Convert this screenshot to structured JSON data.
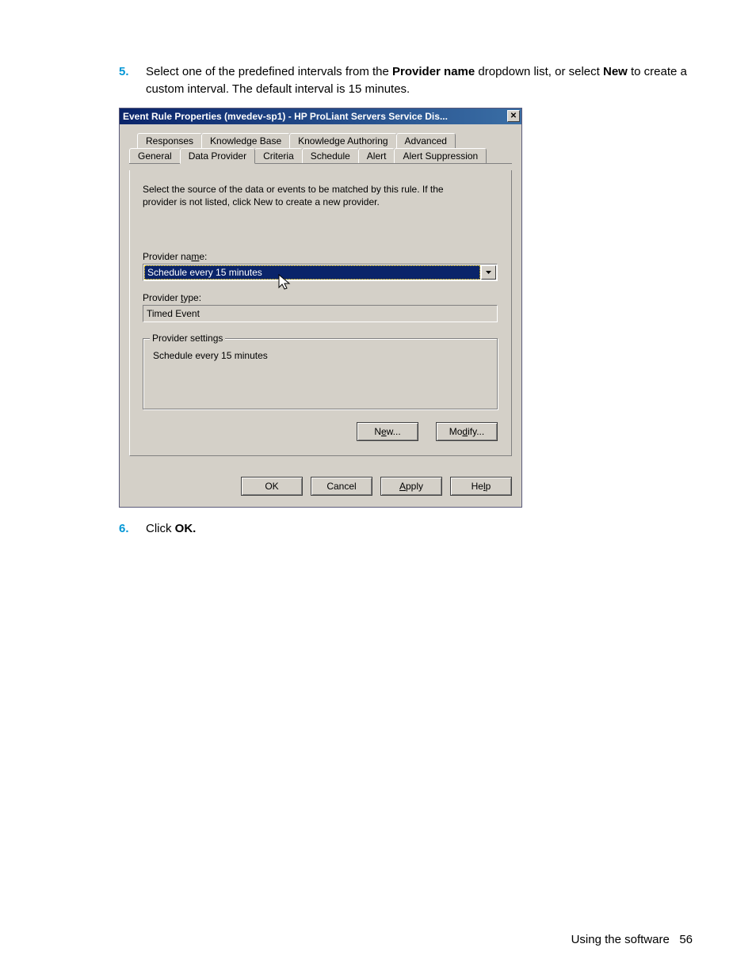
{
  "steps": {
    "s5_num": "5.",
    "s5_pre": "Select one of the predefined intervals from the ",
    "s5_b1": "Provider name",
    "s5_mid": " dropdown list, or select ",
    "s5_b2": "New",
    "s5_post": " to create a custom interval. The default interval is 15 minutes.",
    "s6_num": "6.",
    "s6_pre": "Click ",
    "s6_b1": "OK."
  },
  "dialog": {
    "title": "Event Rule Properties (mvedev-sp1) - HP ProLiant Servers Service Dis...",
    "close": "✕",
    "tabs_back": [
      "Responses",
      "Knowledge Base",
      "Knowledge Authoring",
      "Advanced"
    ],
    "tabs_front": [
      "General",
      "Data Provider",
      "Criteria",
      "Schedule",
      "Alert",
      "Alert Suppression"
    ],
    "instruction": "Select the source of the data or events to be matched by this rule.  If the provider is not listed, click New to create a new provider.",
    "provider_name_label_pre": "Provider na",
    "provider_name_label_u": "m",
    "provider_name_label_post": "e:",
    "provider_name_value": "Schedule every 15 minutes",
    "provider_type_label_pre": "Provider ",
    "provider_type_label_u": "t",
    "provider_type_label_post": "ype:",
    "provider_type_value": "Timed Event",
    "group_title": "Provider settings",
    "group_text": "Schedule every 15 minutes",
    "btn_new_pre": "N",
    "btn_new_u": "e",
    "btn_new_post": "w...",
    "btn_modify_pre": "Mo",
    "btn_modify_u": "d",
    "btn_modify_post": "ify...",
    "btn_ok": "OK",
    "btn_cancel": "Cancel",
    "btn_apply_u": "A",
    "btn_apply_post": "pply",
    "btn_help_pre": "He",
    "btn_help_u": "l",
    "btn_help_post": "p"
  },
  "footer": {
    "text": "Using the software",
    "page": "56"
  }
}
